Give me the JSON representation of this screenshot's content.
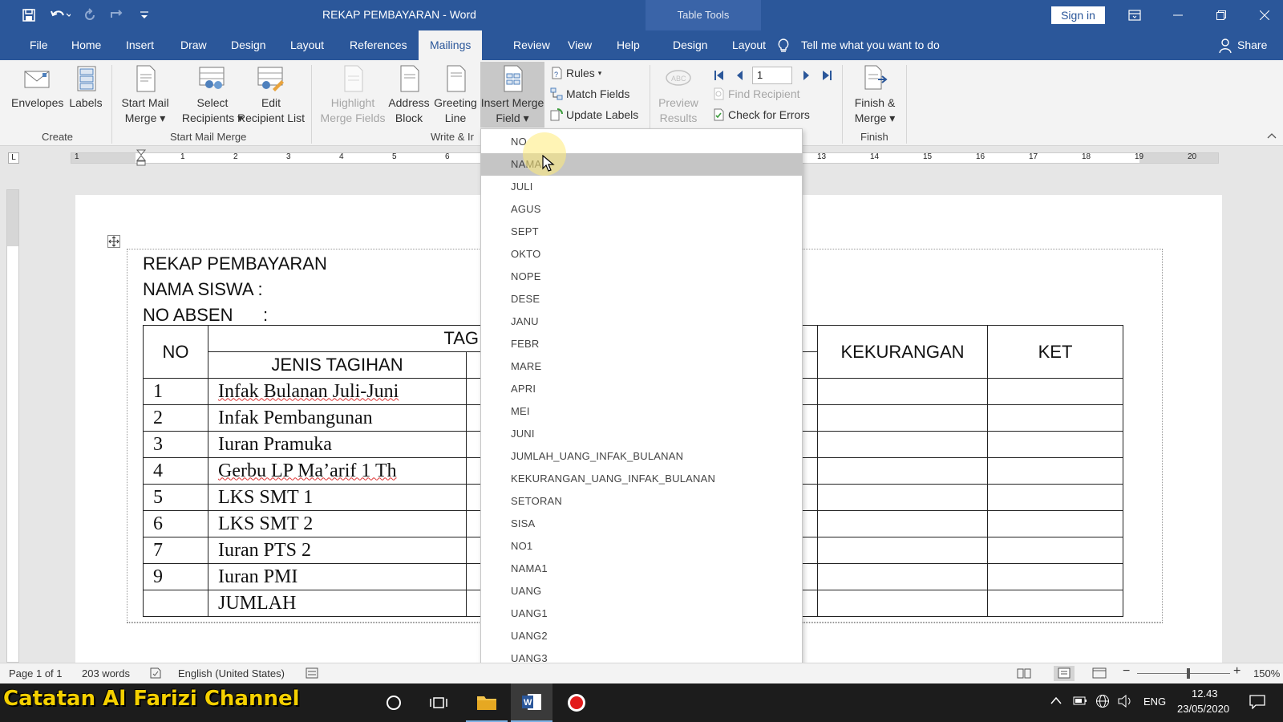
{
  "app": {
    "window_title": "REKAP PEMBAYARAN  -  Word",
    "context_tab": "Table Tools",
    "sign_in": "Sign in"
  },
  "tabs": [
    "File",
    "Home",
    "Insert",
    "Draw",
    "Design",
    "Layout",
    "References",
    "Mailings",
    "Review",
    "View",
    "Help",
    "Design",
    "Layout"
  ],
  "active_tab": "Mailings",
  "tell_me": "Tell me what you want to do",
  "share": "Share",
  "ribbon": {
    "envelopes": "Envelopes",
    "labels": "Labels",
    "start_mail_merge": [
      "Start Mail",
      "Merge"
    ],
    "select_recipients": [
      "Select",
      "Recipients"
    ],
    "edit_recipient_list": [
      "Edit",
      "Recipient List"
    ],
    "highlight_merge_fields": [
      "Highlight",
      "Merge Fields"
    ],
    "address_block": [
      "Address",
      "Block"
    ],
    "greeting_line": [
      "Greeting",
      "Line"
    ],
    "insert_merge_field": [
      "Insert Merge",
      "Field"
    ],
    "rules": "Rules",
    "match_fields": "Match Fields",
    "update_labels": "Update Labels",
    "preview_results": [
      "Preview",
      "Results"
    ],
    "record_number": "1",
    "find_recipient": "Find Recipient",
    "check_for_errors": "Check for Errors",
    "finish_merge": [
      "Finish &",
      "Merge"
    ],
    "groups": [
      "Create",
      "Start Mail Merge",
      "Write & Ir",
      "Finish"
    ]
  },
  "ruler_numbers": [
    "1",
    "1",
    "2",
    "3",
    "4",
    "5",
    "6",
    "13",
    "14",
    "15",
    "16",
    "17",
    "18",
    "19",
    "20"
  ],
  "document": {
    "title": "REKAP PEMBAYARAN",
    "nama_siswa": "NAMA SISWA  :",
    "no_absen": "NO ABSEN",
    "no_absen_colon": ":",
    "table_headers": {
      "no": "NO",
      "tagihan": "TAGIHAN",
      "jenis_tagihan": "JENIS TAGIHAN",
      "kekurangan": "KEKURANGAN",
      "ket": "KET"
    },
    "rows": [
      {
        "no": "1",
        "jenis": "Infak Bulanan Juli-Juni"
      },
      {
        "no": "2",
        "jenis": "Infak Pembangunan"
      },
      {
        "no": "3",
        "jenis": "Iuran Pramuka"
      },
      {
        "no": "4",
        "jenis": "Gerbu LP Ma’arif 1 Th"
      },
      {
        "no": "5",
        "jenis": "LKS SMT 1"
      },
      {
        "no": "6",
        "jenis": "LKS SMT 2"
      },
      {
        "no": "7",
        "jenis": "Iuran PTS 2"
      },
      {
        "no": "9",
        "jenis": "Iuran PMI"
      },
      {
        "no": "",
        "jenis": "JUMLAH"
      }
    ]
  },
  "merge_fields": [
    "NO",
    "NAMA",
    "JULI",
    "AGUS",
    "SEPT",
    "OKTO",
    "NOPE",
    "DESE",
    "JANU",
    "FEBR",
    "MARE",
    "APRI",
    "MEI",
    "JUNI",
    "JUMLAH_UANG_INFAK_BULANAN",
    "KEKURANGAN_UANG_INFAK_BULANAN",
    "SETORAN",
    "SISA",
    "NO1",
    "NAMA1",
    "UANG",
    "UANG1",
    "UANG2",
    "UANG3"
  ],
  "highlighted_field": "NAMA",
  "status": {
    "page": "Page 1 of 1",
    "words": "203 words",
    "language": "English (United States)",
    "zoom": "150%"
  },
  "taskbar": {
    "watermark": "Catatan Al Farizi Channel",
    "lang": "ENG",
    "time": "12.43",
    "date": "23/05/2020"
  },
  "colors": {
    "word_blue": "#2b579a",
    "ribbon_bg": "#f3f3f3",
    "highlight": "#c5c5c5",
    "watermark": "#f5d000"
  }
}
